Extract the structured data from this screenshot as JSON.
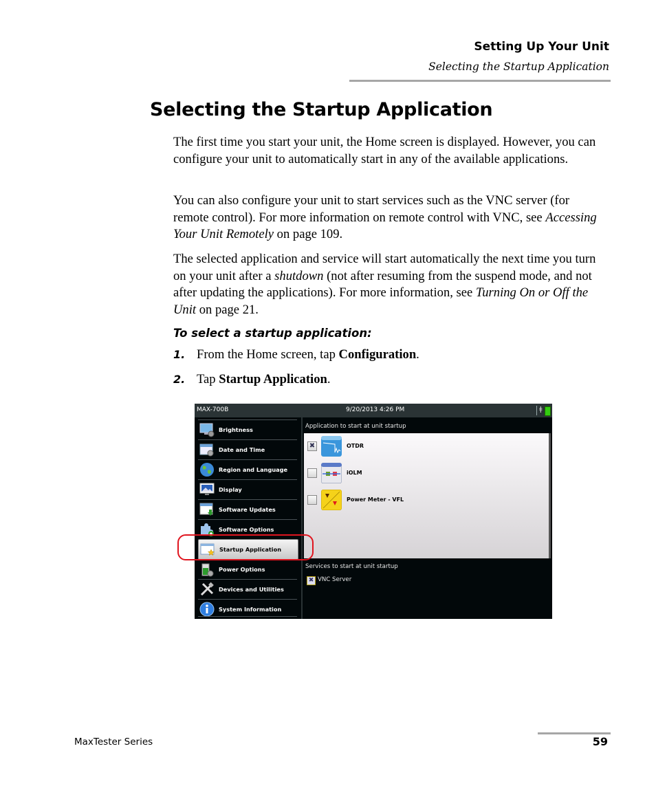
{
  "header": {
    "chapter": "Setting Up Your Unit",
    "section": "Selecting the Startup Application"
  },
  "title": "Selecting the Startup Application",
  "paragraphs": {
    "p1": "The first time you start your unit, the Home screen is displayed. However, you can configure your unit to automatically start in any of the available applications.",
    "p2_a": "You can also configure your unit to start services such as the VNC server (for remote control). For more information on remote control with VNC, see ",
    "p2_link": "Accessing Your Unit Remotely",
    "p2_b": " on page 109.",
    "p3_a": "The selected application and service will start automatically the next time you turn on your unit after a ",
    "p3_em": "shutdown",
    "p3_b": " (not after resuming from the suspend mode, and not after updating the applications). For more information, see ",
    "p3_link": "Turning On or Off the Unit",
    "p3_c": " on page 21."
  },
  "procedure": {
    "title": "To select a startup application:",
    "steps": [
      {
        "num": "1.",
        "pre": "From the Home screen, tap ",
        "bold": "Configuration",
        "post": "."
      },
      {
        "num": "2.",
        "pre": "Tap ",
        "bold": "Startup Application",
        "post": "."
      }
    ]
  },
  "screenshot": {
    "status": {
      "model": "MAX-700B",
      "datetime": "9/20/2013 4:26 PM",
      "battery_color": "#33cc11"
    },
    "sidebar": [
      {
        "label": "Brightness",
        "icon": "monitor-gear-icon"
      },
      {
        "label": "Date and Time",
        "icon": "calendar-gear-icon"
      },
      {
        "label": "Region and Language",
        "icon": "globe-icon"
      },
      {
        "label": "Display",
        "icon": "display-icon"
      },
      {
        "label": "Software Updates",
        "icon": "window-download-icon"
      },
      {
        "label": "Software Options",
        "icon": "puzzle-plus-icon"
      },
      {
        "label": "Startup Application",
        "icon": "window-star-icon",
        "selected": true
      },
      {
        "label": "Power Options",
        "icon": "battery-gear-icon"
      },
      {
        "label": "Devices and Utilities",
        "icon": "tools-icon"
      },
      {
        "label": "System Information",
        "icon": "info-icon"
      }
    ],
    "apps_label": "Application to start at unit startup",
    "apps": [
      {
        "name": "OTDR",
        "checked": true
      },
      {
        "name": "iOLM",
        "checked": false
      },
      {
        "name": "Power Meter - VFL",
        "checked": false
      }
    ],
    "services_label": "Services to start at unit startup",
    "services": [
      {
        "name": "VNC Server",
        "checked": true
      }
    ],
    "check_mark": "✖",
    "highlight_color": "#e0141e"
  },
  "footer": {
    "product": "MaxTester Series",
    "page": "59"
  }
}
